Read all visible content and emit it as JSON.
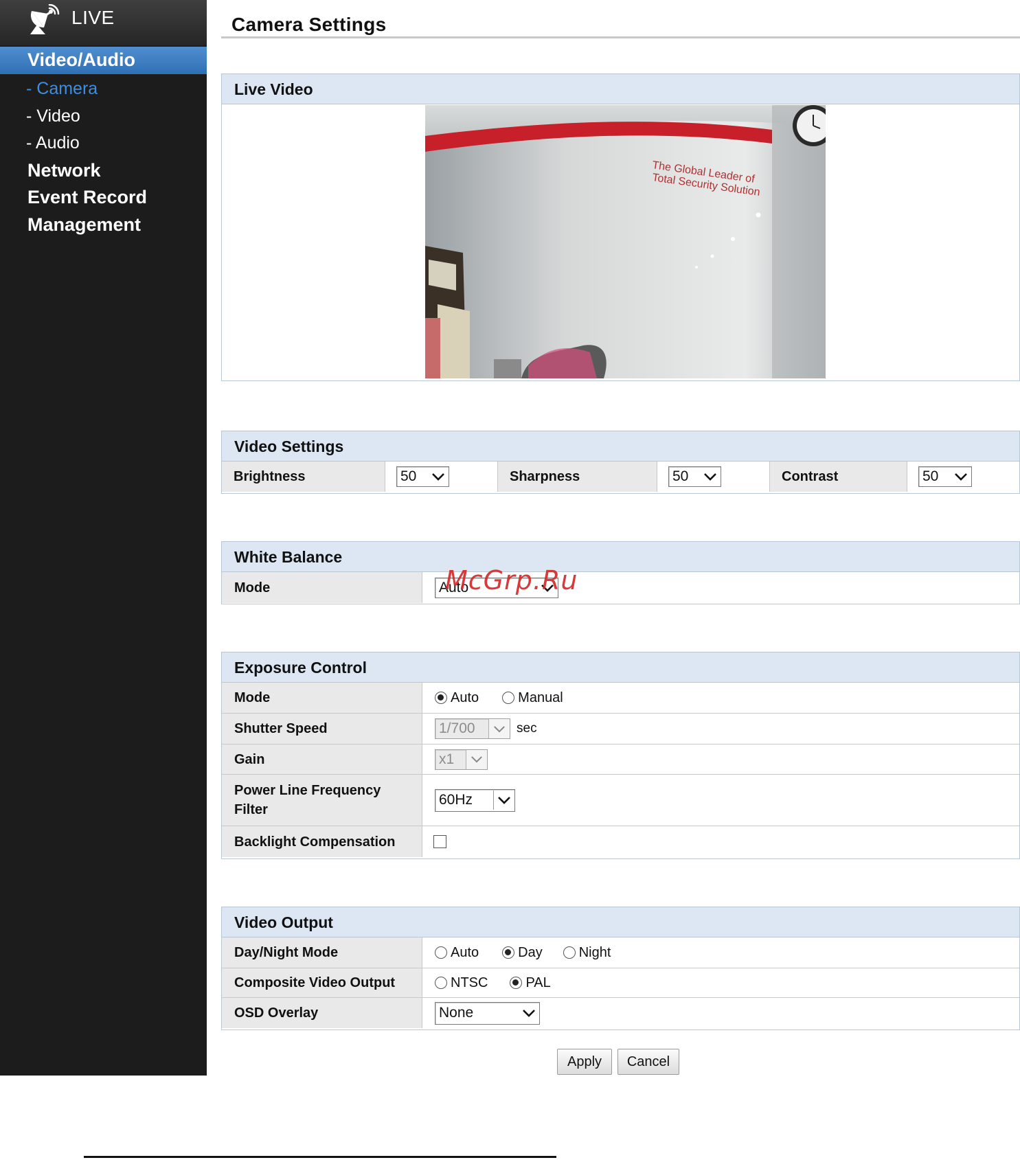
{
  "sidebar": {
    "live_label": "LIVE",
    "items": [
      {
        "label": "Video/Audio"
      },
      {
        "label": "- Camera"
      },
      {
        "label": "- Video"
      },
      {
        "label": "- Audio"
      },
      {
        "label": "Network"
      },
      {
        "label": "Event Record"
      },
      {
        "label": "Management"
      }
    ]
  },
  "page": {
    "title": "Camera Settings"
  },
  "live_video": {
    "heading": "Live Video",
    "overlay_text_line1": "The Global Leader of",
    "overlay_text_line2": "Total Security Solution"
  },
  "video_settings": {
    "heading": "Video Settings",
    "brightness": {
      "label": "Brightness",
      "value": "50"
    },
    "sharpness": {
      "label": "Sharpness",
      "value": "50"
    },
    "contrast": {
      "label": "Contrast",
      "value": "50"
    }
  },
  "white_balance": {
    "heading": "White Balance",
    "mode": {
      "label": "Mode",
      "value": "Auto"
    }
  },
  "exposure": {
    "heading": "Exposure Control",
    "mode": {
      "label": "Mode",
      "options": [
        "Auto",
        "Manual"
      ],
      "selected": "Auto"
    },
    "shutter": {
      "label": "Shutter Speed",
      "value": "1/700",
      "unit": "sec"
    },
    "gain": {
      "label": "Gain",
      "value": "x1"
    },
    "power_line": {
      "label_line1": "Power Line Frequency",
      "label_line2": "Filter",
      "value": "60Hz"
    },
    "backlight": {
      "label": "Backlight Compensation",
      "checked": false
    }
  },
  "video_output": {
    "heading": "Video Output",
    "day_night": {
      "label": "Day/Night Mode",
      "options": [
        "Auto",
        "Day",
        "Night"
      ],
      "selected": "Day"
    },
    "composite": {
      "label": "Composite Video Output",
      "options": [
        "NTSC",
        "PAL"
      ],
      "selected": "PAL"
    },
    "osd": {
      "label": "OSD Overlay",
      "value": "None"
    }
  },
  "buttons": {
    "apply": "Apply",
    "cancel": "Cancel"
  },
  "watermark": "McGrp.Ru",
  "colors": {
    "sidebar_bg": "#1c1c1c",
    "active_nav_bg": "#3a7cc2",
    "active_sub_text": "#3c8fe0",
    "panel_header_bg": "#dce7f3",
    "label_cell_bg": "#e9e9e9",
    "watermark": "#d42a2a"
  },
  "icons": {
    "live": "satellite-dish-icon",
    "select_arrow": "chevron-down-icon"
  }
}
